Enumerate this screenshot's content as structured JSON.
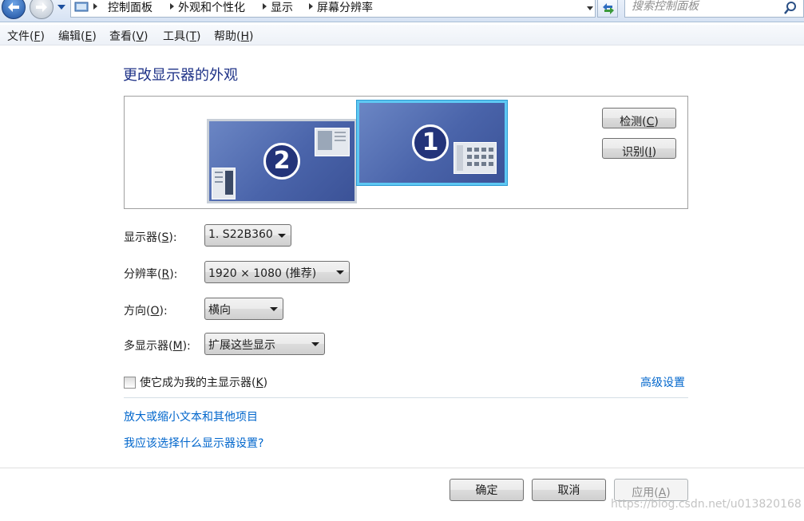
{
  "address_bar": {
    "breadcrumbs": [
      "控制面板",
      "外观和个性化",
      "显示",
      "屏幕分辨率"
    ],
    "search_placeholder": "搜索控制面板"
  },
  "menu": {
    "items": [
      {
        "label": "文件",
        "key": "F"
      },
      {
        "label": "编辑",
        "key": "E"
      },
      {
        "label": "查看",
        "key": "V"
      },
      {
        "label": "工具",
        "key": "T"
      },
      {
        "label": "帮助",
        "key": "H"
      }
    ]
  },
  "main": {
    "title": "更改显示器的外观",
    "monitors": [
      {
        "number": "1",
        "selected": true
      },
      {
        "number": "2",
        "selected": false
      }
    ],
    "detect_button": {
      "label": "检测",
      "key": "C"
    },
    "identify_button": {
      "label": "识别",
      "key": "I"
    },
    "fields": {
      "display": {
        "label": "显示器",
        "key": "S",
        "value": "1. S22B360"
      },
      "resolution": {
        "label": "分辨率",
        "key": "R",
        "value": "1920 × 1080 (推荐)"
      },
      "orientation": {
        "label": "方向",
        "key": "O",
        "value": "横向"
      },
      "multiple_displays": {
        "label": "多显示器",
        "key": "M",
        "value": "扩展这些显示"
      }
    },
    "primary_checkbox": {
      "label": "使它成为我的主显示器",
      "key": "K",
      "checked": false
    },
    "advanced_link": "高级设置",
    "links": [
      "放大或缩小文本和其他项目",
      "我应该选择什么显示器设置?"
    ]
  },
  "footer": {
    "ok": {
      "label": "确定"
    },
    "cancel": {
      "label": "取消"
    },
    "apply": {
      "label": "应用",
      "key": "A",
      "disabled": true
    }
  },
  "watermark": "https://blog.csdn.net/u013820168",
  "colors": {
    "title": "#1e3287",
    "link": "#0066cc",
    "monitor_fill": "#4a64aa",
    "selected_border": "#5ec8f3"
  }
}
